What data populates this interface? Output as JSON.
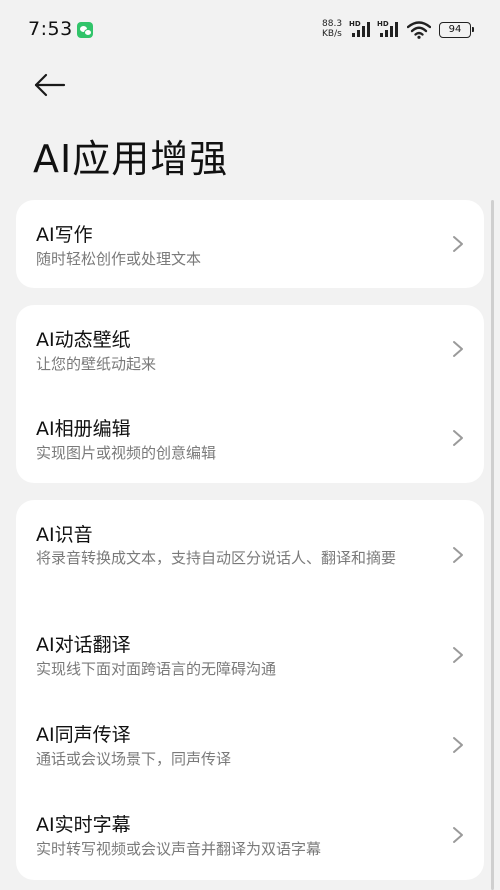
{
  "status_bar": {
    "time": "7:53",
    "net_speed_value": "88.3",
    "net_speed_unit": "KB/s",
    "sim1_label": "HD",
    "sim2_label": "HD",
    "battery": "94"
  },
  "header": {
    "title": "AI应用增强"
  },
  "cards": [
    {
      "items": [
        {
          "title": "AI写作",
          "desc": "随时轻松创作或处理文本"
        }
      ]
    },
    {
      "items": [
        {
          "title": "AI动态壁纸",
          "desc": "让您的壁纸动起来"
        },
        {
          "title": "AI相册编辑",
          "desc": "实现图片或视频的创意编辑"
        }
      ]
    },
    {
      "items": [
        {
          "title": "AI识音",
          "desc": "将录音转换成文本，支持自动区分说话人、翻译和摘要"
        },
        {
          "title": "AI对话翻译",
          "desc": "实现线下面对面跨语言的无障碍沟通"
        },
        {
          "title": "AI同声传译",
          "desc": "通话或会议场景下，同声传译"
        },
        {
          "title": "AI实时字幕",
          "desc": "实时转写视频或会议声音并翻译为双语字幕"
        }
      ]
    }
  ],
  "icons": {
    "back": "arrow-left-icon",
    "chevron": "chevron-right-icon",
    "wifi": "wifi-icon",
    "app_notification": "wechat-icon"
  },
  "colors": {
    "background": "#f2f2f2",
    "card": "#ffffff",
    "title_text": "#111111",
    "desc_text": "#7a7a7a",
    "chevron": "#9a9a9a"
  }
}
